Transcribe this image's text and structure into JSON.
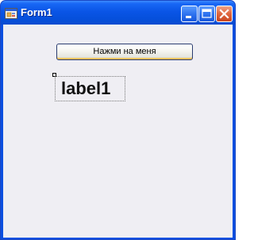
{
  "window": {
    "title": "Form1",
    "icon": "form-app-icon",
    "titlebar_color": "#0a55e6",
    "client_color": "#efeef3",
    "controls": {
      "minimize_icon": "minimize-icon",
      "maximize_icon": "maximize-icon",
      "close_icon": "close-icon"
    }
  },
  "form": {
    "button_label": "Нажми на меня",
    "label_text": "label1"
  }
}
